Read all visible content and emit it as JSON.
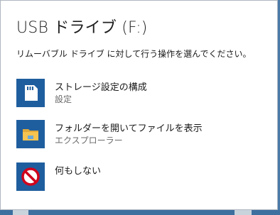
{
  "dialog": {
    "title": "USB ドライブ (F:)",
    "prompt": "リムーバブル ドライブ に対して行う操作を選んでください。"
  },
  "options": [
    {
      "label": "ストレージ設定の構成",
      "sub": "設定",
      "icon": "sd-card-icon"
    },
    {
      "label": "フォルダーを開いてファイルを表示",
      "sub": "エクスプローラー",
      "icon": "folder-icon"
    },
    {
      "label": "何もしない",
      "sub": "",
      "icon": "no-entry-icon"
    }
  ],
  "colors": {
    "tile": "#1f5e9e",
    "no_entry": "#d0021b",
    "folder": "#f5c451"
  }
}
